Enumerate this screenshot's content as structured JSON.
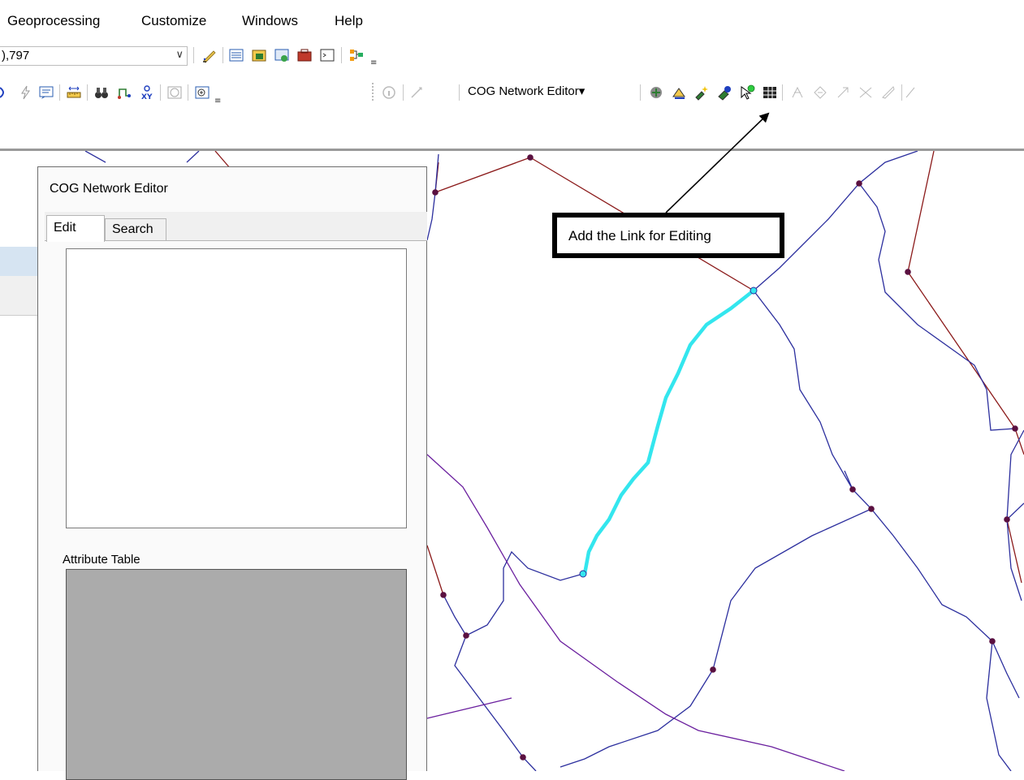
{
  "menu": {
    "items": [
      "Geoprocessing",
      "Customize",
      "Windows",
      "Help"
    ]
  },
  "scale": {
    "value": "),797"
  },
  "toolbar": {
    "cog_dropdown_label": "COG Network Editor▾"
  },
  "panel": {
    "title": "COG Network Editor",
    "tabs": [
      {
        "label": "Edit",
        "active": true
      },
      {
        "label": "Search",
        "active": false
      }
    ],
    "attribute_table_label": "Attribute Table"
  },
  "callout": {
    "text": "Add the Link for Editing"
  },
  "colors": {
    "highlighted_link": "#33e6ee",
    "network_link_blue": "#2c2f9e",
    "network_link_red": "#8b1a1a",
    "network_link_purple": "#6a1f9e",
    "node": "#5a1040",
    "attribute_table_bg": "#ababab"
  }
}
